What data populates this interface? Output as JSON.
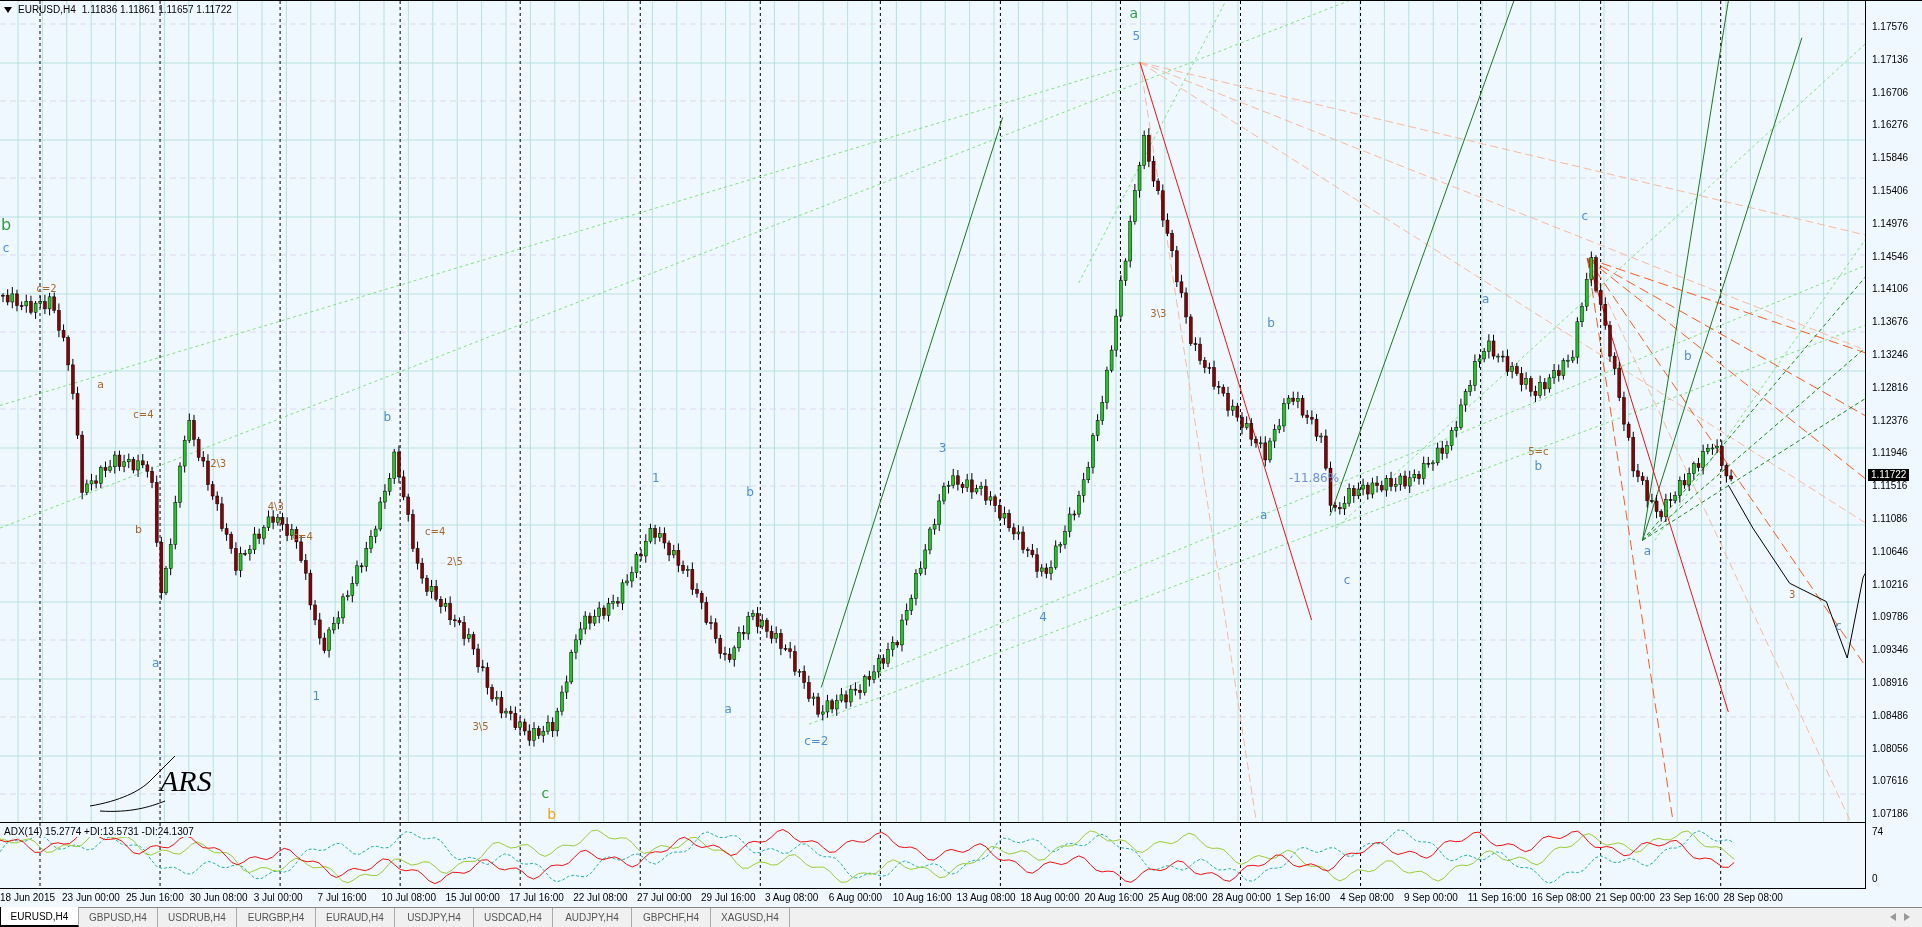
{
  "chart": {
    "symbol": "EURUSD,H4",
    "quotes": [
      "1.11836",
      "1.11861",
      "1.11657",
      "1.11722"
    ]
  },
  "price_axis": {
    "labels": [
      "1.17576",
      "1.17136",
      "1.16706",
      "1.16276",
      "1.15846",
      "1.15406",
      "1.14976",
      "1.14546",
      "1.14106",
      "1.13676",
      "1.13246",
      "1.12816",
      "1.12376",
      "1.11946",
      "1.11516",
      "1.11086",
      "1.10646",
      "1.10216",
      "1.09786",
      "1.09346",
      "1.08916",
      "1.08486",
      "1.08056",
      "1.07616",
      "1.07186"
    ],
    "current_price": "1.11722"
  },
  "wave_labels": [
    {
      "text": "b",
      "color": "#2e9e44"
    },
    {
      "text": "c",
      "color": "#4f8fcf"
    },
    {
      "text": "c=2",
      "color": "#a5672a"
    },
    {
      "text": "a",
      "color": "#a5672a"
    },
    {
      "text": "b",
      "color": "#a5672a"
    },
    {
      "text": "c=4",
      "color": "#a5672a"
    },
    {
      "text": "a",
      "color": "#4f8fcf"
    },
    {
      "text": "2\\3",
      "color": "#a5672a"
    },
    {
      "text": "4\\3",
      "color": "#a5672a"
    },
    {
      "text": "c=4",
      "color": "#a5672a"
    },
    {
      "text": "1",
      "color": "#4f8fcf"
    },
    {
      "text": "b",
      "color": "#4f8fcf"
    },
    {
      "text": "c=4",
      "color": "#a5672a"
    },
    {
      "text": "2\\5",
      "color": "#a5672a"
    },
    {
      "text": "3\\5",
      "color": "#a5672a"
    },
    {
      "text": "c",
      "color": "#2e9e44"
    },
    {
      "text": "b",
      "color": "#f0a010"
    },
    {
      "text": "1",
      "color": "#4f8fcf"
    },
    {
      "text": "b",
      "color": "#4f8fcf"
    },
    {
      "text": "a",
      "color": "#4f8fcf"
    },
    {
      "text": "c=2",
      "color": "#4f8fcf"
    },
    {
      "text": "3",
      "color": "#4f8fcf"
    },
    {
      "text": "4",
      "color": "#4f8fcf"
    },
    {
      "text": "a",
      "color": "#2e9e44"
    },
    {
      "text": "5",
      "color": "#4f8fcf"
    },
    {
      "text": "3\\3",
      "color": "#a5672a"
    },
    {
      "text": "b",
      "color": "#4f8fcf"
    },
    {
      "text": "a",
      "color": "#4f8fcf"
    },
    {
      "text": "-11.86%",
      "color": "#6a8fe0"
    },
    {
      "text": "c",
      "color": "#4f8fcf"
    },
    {
      "text": "a",
      "color": "#4f8fcf"
    },
    {
      "text": "5=c",
      "color": "#a5672a"
    },
    {
      "text": "b",
      "color": "#4f8fcf"
    },
    {
      "text": "c",
      "color": "#4f8fcf"
    },
    {
      "text": "b",
      "color": "#4f8fcf"
    },
    {
      "text": "a",
      "color": "#4f8fcf"
    },
    {
      "text": "3",
      "color": "#a5672a"
    },
    {
      "text": "c",
      "color": "#4f8fcf"
    }
  ],
  "signature": "ARS",
  "indicator": {
    "title": "ADX(14) 15.2774 +DI:13.5731 -DI:24.1307",
    "axis_labels": [
      "74",
      "0"
    ]
  },
  "time_axis": {
    "labels": [
      "18 Jun 2015",
      "23 Jun 00:00",
      "25 Jun 16:00",
      "30 Jun 08:00",
      "3 Jul 00:00",
      "7 Jul 16:00",
      "10 Jul 08:00",
      "15 Jul 00:00",
      "17 Jul 16:00",
      "22 Jul 08:00",
      "27 Jul 00:00",
      "29 Jul 16:00",
      "3 Aug 08:00",
      "6 Aug 00:00",
      "10 Aug 16:00",
      "13 Aug 08:00",
      "18 Aug 00:00",
      "20 Aug 16:00",
      "25 Aug 08:00",
      "28 Aug 00:00",
      "1 Sep 16:00",
      "4 Sep 08:00",
      "9 Sep 00:00",
      "11 Sep 16:00",
      "16 Sep 08:00",
      "21 Sep 00:00",
      "23 Sep 16:00",
      "28 Sep 08:00"
    ]
  },
  "tabs": [
    {
      "label": "EURUSD,H4",
      "selected": true
    },
    {
      "label": "GBPUSD,H4",
      "selected": false
    },
    {
      "label": "USDRUB,H4",
      "selected": false
    },
    {
      "label": "EURGBP,H4",
      "selected": false
    },
    {
      "label": "EURAUD,H4",
      "selected": false
    },
    {
      "label": "USDJPY,H4",
      "selected": false
    },
    {
      "label": "USDCAD,H4",
      "selected": false
    },
    {
      "label": "AUDJPY,H4",
      "selected": false
    },
    {
      "label": "GBPCHF,H4",
      "selected": false
    },
    {
      "label": "XAGUSD,H4",
      "selected": false
    }
  ]
}
